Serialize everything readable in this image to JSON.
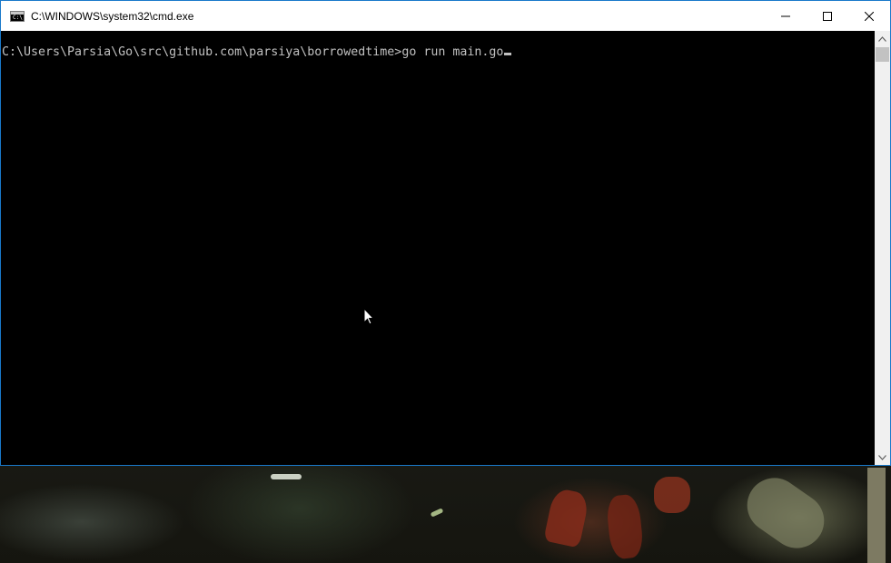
{
  "window": {
    "title": "C:\\WINDOWS\\system32\\cmd.exe",
    "icon": "cmd-icon",
    "icon_text": "C:\\",
    "controls": [
      "minimize-icon",
      "maximize-icon",
      "close-icon"
    ]
  },
  "console": {
    "prompt": "C:\\Users\\Parsia\\Go\\src\\github.com\\parsiya\\borrowedtime>",
    "command": "go run main.go"
  },
  "colors": {
    "console_background": "#000000",
    "console_text": "#c0c0c0",
    "window_border": "#1979ca",
    "titlebar": "#ffffff"
  }
}
